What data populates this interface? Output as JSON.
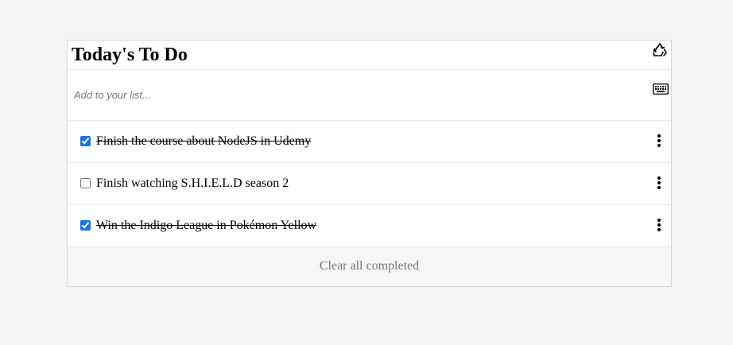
{
  "header": {
    "title": "Today's To Do",
    "recycle_icon": "recycle-icon"
  },
  "add_input": {
    "placeholder": "Add to your list...",
    "value": "",
    "keyboard_icon": "keyboard-icon"
  },
  "todos": [
    {
      "text": "Finish the course about NodeJS in Udemy",
      "completed": true
    },
    {
      "text": "Finish watching S.H.I.E.L.D season 2",
      "completed": false
    },
    {
      "text": "Win the Indigo League in Pokémon Yellow",
      "completed": true
    }
  ],
  "item_menu_icon": "kebab-menu-icon",
  "footer": {
    "clear_label": "Clear all completed"
  },
  "colors": {
    "page_background": "#f4f4f4",
    "card_background": "#ffffff",
    "footer_background": "#f6f6f6",
    "checkbox_accent": "#1a73e8",
    "muted_text": "#777777"
  }
}
